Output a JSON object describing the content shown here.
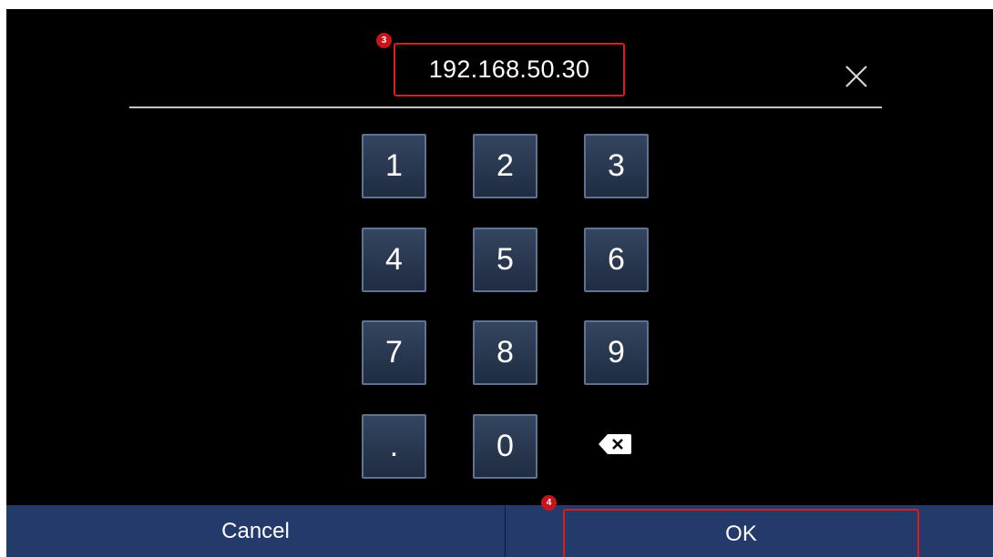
{
  "ip_field": {
    "value": "192.168.50.30"
  },
  "badges": {
    "field": "3",
    "ok": "4"
  },
  "keypad": {
    "keys": [
      "1",
      "2",
      "3",
      "4",
      "5",
      "6",
      "7",
      "8",
      "9",
      ".",
      "0"
    ]
  },
  "icons": {
    "close": "close-icon",
    "backspace": "backspace-icon"
  },
  "footer": {
    "cancel_label": "Cancel",
    "ok_label": "OK"
  },
  "colors": {
    "background": "#000000",
    "key_fill": "#2a3a55",
    "key_border": "#5d7391",
    "footer_bar": "#233a6b",
    "highlight": "#e01919"
  }
}
